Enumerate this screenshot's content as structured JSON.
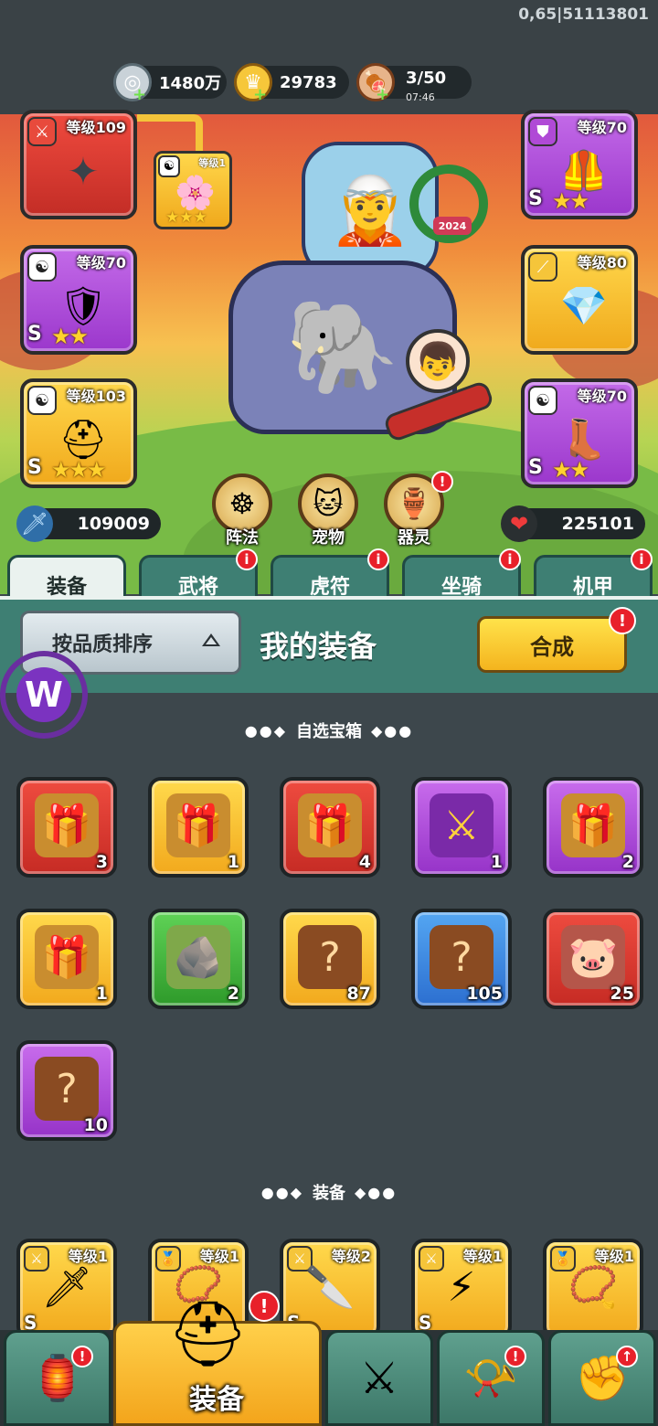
{
  "corner_id": "0,65|51113801",
  "resources": [
    {
      "icon": "silver-coin-icon",
      "value": "1480万"
    },
    {
      "icon": "gold-ingot-icon",
      "value": "29783"
    },
    {
      "icon": "meat-stamina-icon",
      "value": "3/50",
      "timer": "07:46"
    }
  ],
  "hero": {
    "left_slots": [
      {
        "level": "等级109",
        "color": "red",
        "icon": "shuriken-icon"
      },
      {
        "level": "等级70",
        "color": "purple",
        "grade": "S",
        "stars": "★★",
        "icon": "armor-icon"
      },
      {
        "level": "等级103",
        "color": "gold",
        "grade": "S",
        "stars": "★★★",
        "icon": "helmet-icon"
      }
    ],
    "small_slot": {
      "level": "等级1",
      "stars": "★★★"
    },
    "right_slots": [
      {
        "level": "等级70",
        "color": "purple",
        "grade": "S",
        "stars": "★★",
        "icon": "chestplate-icon"
      },
      {
        "level": "等级80",
        "color": "gold",
        "icon": "bracer-icon"
      },
      {
        "level": "等级70",
        "color": "purple",
        "grade": "S",
        "stars": "★★",
        "icon": "boots-icon"
      }
    ],
    "year_badge": "2024",
    "attack_power": "109009",
    "health_power": "225101",
    "circle_buttons": [
      {
        "label": "阵法",
        "icon": "formation-icon"
      },
      {
        "label": "宠物",
        "icon": "pet-cat-icon"
      },
      {
        "label": "器灵",
        "icon": "spirit-icon"
      }
    ]
  },
  "tabs": [
    {
      "label": "装备",
      "active": true
    },
    {
      "label": "武将",
      "badge": "i"
    },
    {
      "label": "虎符",
      "badge": "i"
    },
    {
      "label": "坐骑",
      "badge": "i"
    },
    {
      "label": "机甲",
      "badge": "i"
    }
  ],
  "panel": {
    "sort_label": "按品质排序",
    "title": "我的装备",
    "synth_label": "合成",
    "synth_badge": "!"
  },
  "chest_section": {
    "title": "自选宝箱",
    "items": [
      {
        "color": "red",
        "count": "3"
      },
      {
        "color": "gold",
        "count": "1"
      },
      {
        "color": "red",
        "count": "4"
      },
      {
        "color": "purple",
        "count": "1"
      },
      {
        "color": "purple",
        "count": "2"
      },
      {
        "color": "gold",
        "count": "1"
      },
      {
        "color": "green",
        "count": "2"
      },
      {
        "color": "gold",
        "count": "87"
      },
      {
        "color": "blue",
        "count": "105"
      },
      {
        "color": "red",
        "count": "25"
      },
      {
        "color": "purple",
        "count": "10"
      }
    ]
  },
  "equip_section": {
    "title": "装备",
    "items": [
      {
        "color": "gold",
        "level": "等级1",
        "grade": "S"
      },
      {
        "color": "gold",
        "level": "等级1"
      },
      {
        "color": "gold",
        "level": "等级2",
        "grade": "S"
      },
      {
        "color": "gold",
        "level": "等级1",
        "grade": "S"
      },
      {
        "color": "gold",
        "level": "等级1"
      }
    ]
  },
  "bottom_nav": {
    "active_label": "装备",
    "badge": "!"
  }
}
